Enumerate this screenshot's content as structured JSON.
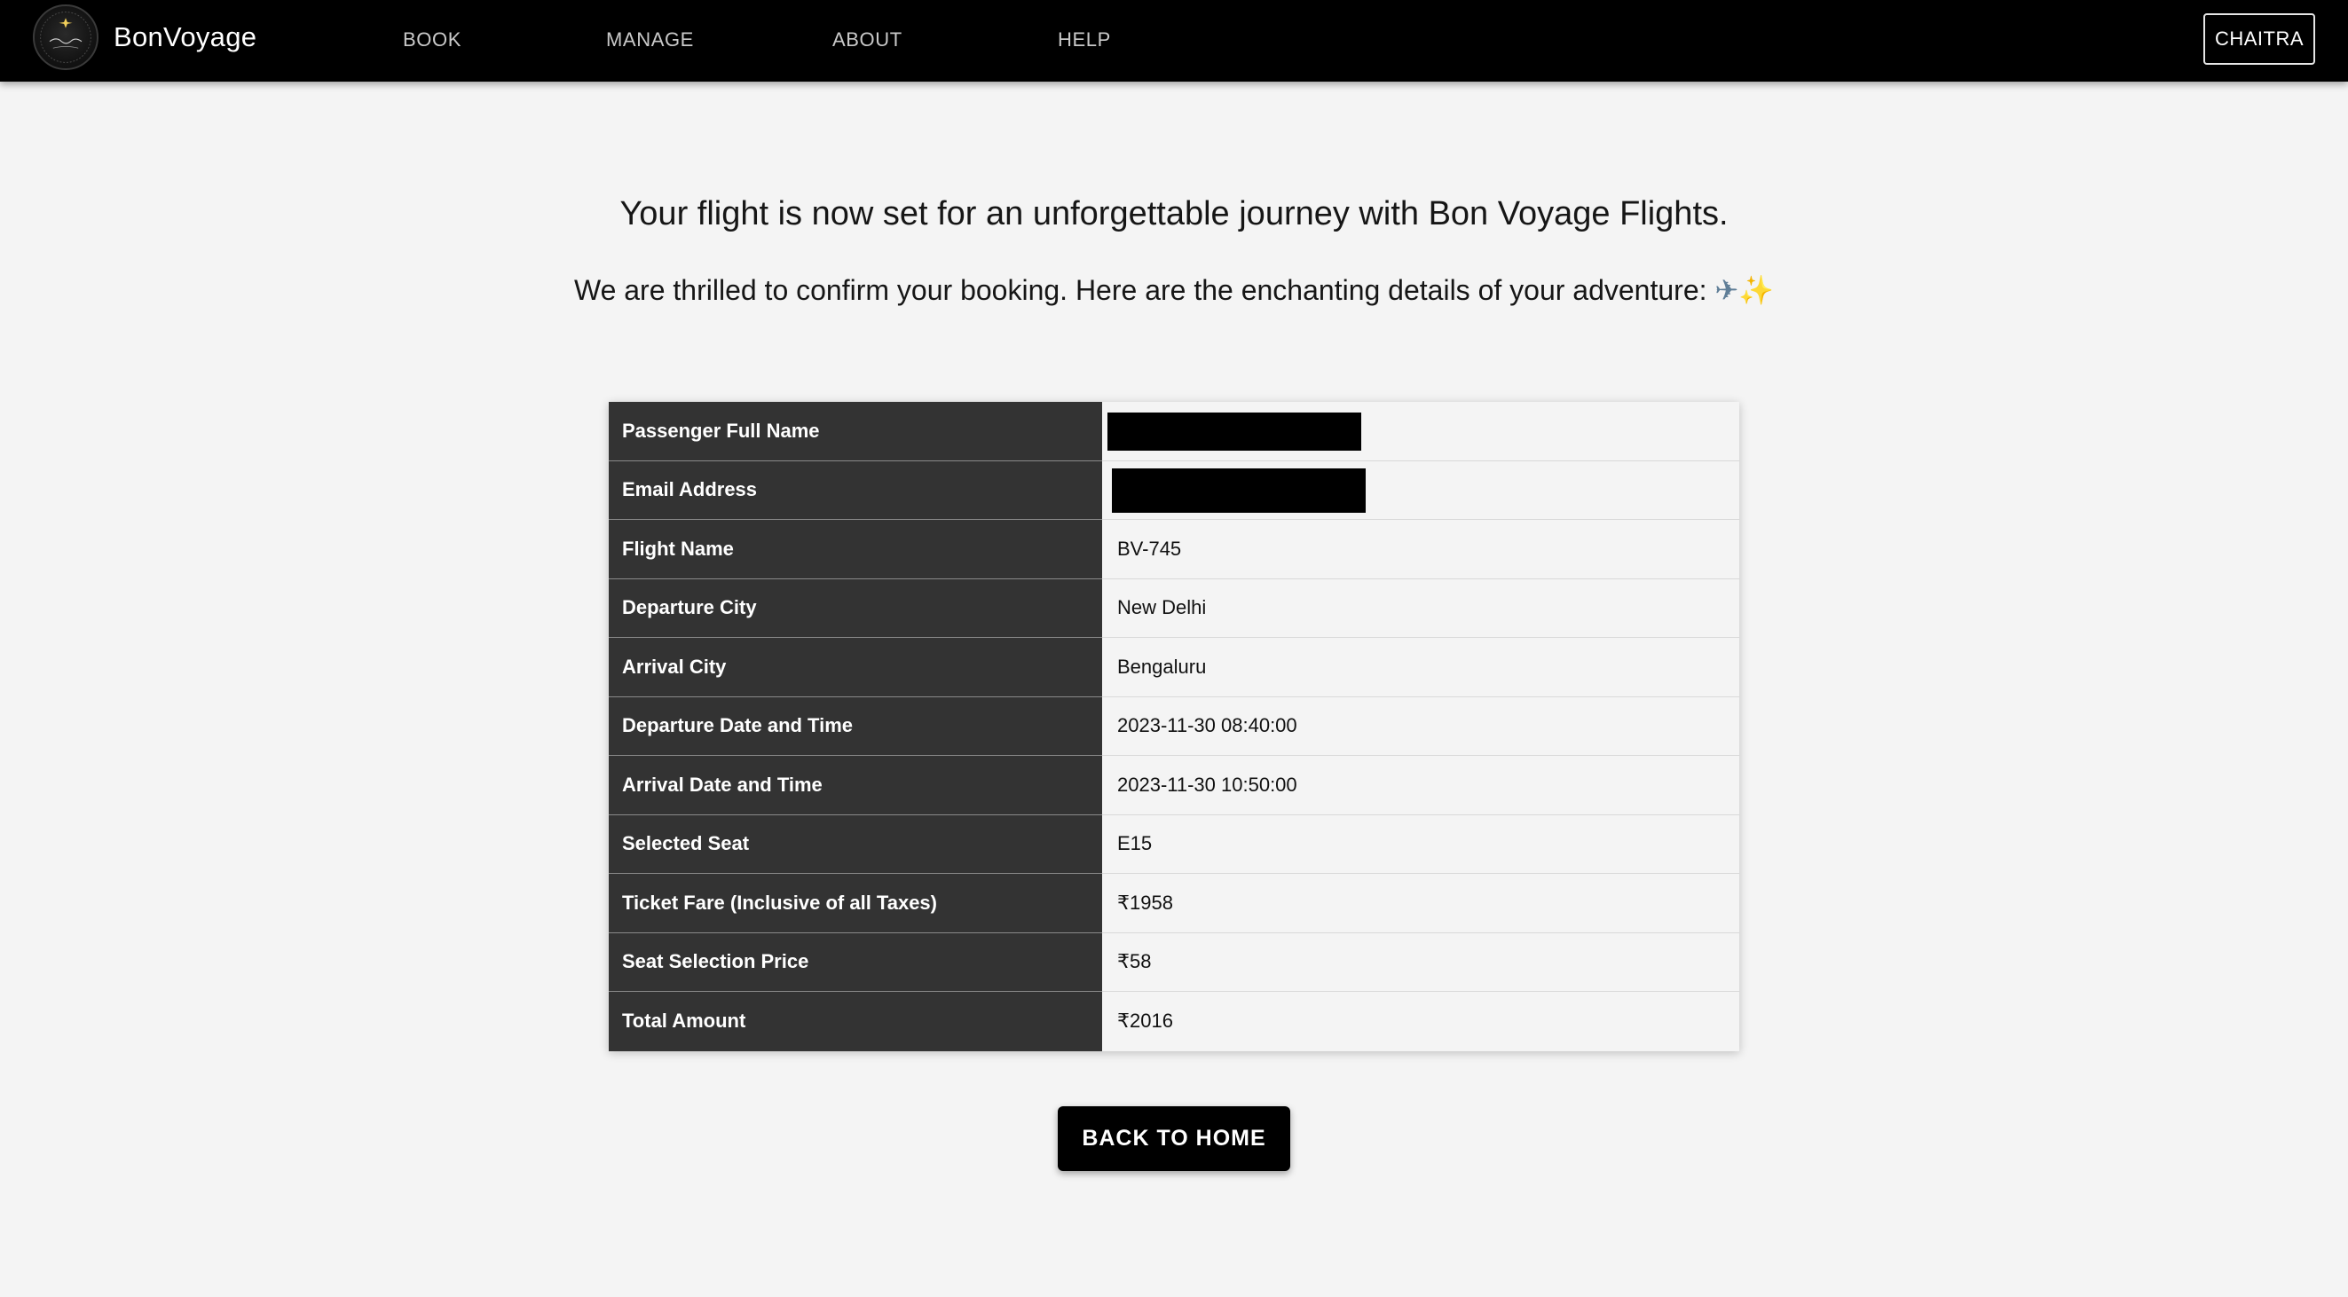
{
  "navbar": {
    "brand": "BonVoyage",
    "links": [
      "BOOK",
      "MANAGE",
      "ABOUT",
      "HELP"
    ],
    "user_button": "CHAITRA"
  },
  "headline": "Your flight is now set for an unforgettable journey with Bon Voyage Flights.",
  "subline": "We are thrilled to confirm your booking. Here are the enchanting details of your adventure:",
  "booking_details": {
    "rows": [
      {
        "label": "Passenger Full Name",
        "value": "",
        "redacted": true
      },
      {
        "label": "Email Address",
        "value": "",
        "redacted": true
      },
      {
        "label": "Flight Name",
        "value": "BV-745"
      },
      {
        "label": "Departure City",
        "value": "New Delhi"
      },
      {
        "label": "Arrival City",
        "value": "Bengaluru"
      },
      {
        "label": "Departure Date and Time",
        "value": "2023-11-30 08:40:00"
      },
      {
        "label": "Arrival Date and Time",
        "value": "2023-11-30 10:50:00"
      },
      {
        "label": "Selected Seat",
        "value": "E15"
      },
      {
        "label": "Ticket Fare (Inclusive of all Taxes)",
        "value": "₹1958"
      },
      {
        "label": "Seat Selection Price",
        "value": "₹58"
      },
      {
        "label": "Total Amount",
        "value": "₹2016"
      }
    ]
  },
  "back_button": "BACK TO HOME",
  "colors": {
    "navbar_bg": "#000000",
    "page_bg": "#f4f4f4",
    "label_cell_bg": "#333333",
    "button_bg": "#000000"
  },
  "icons": {
    "logo": "bon-voyage-logo-icon",
    "emoji_1": "airplane-icon",
    "emoji_2": "sparkles-icon"
  }
}
